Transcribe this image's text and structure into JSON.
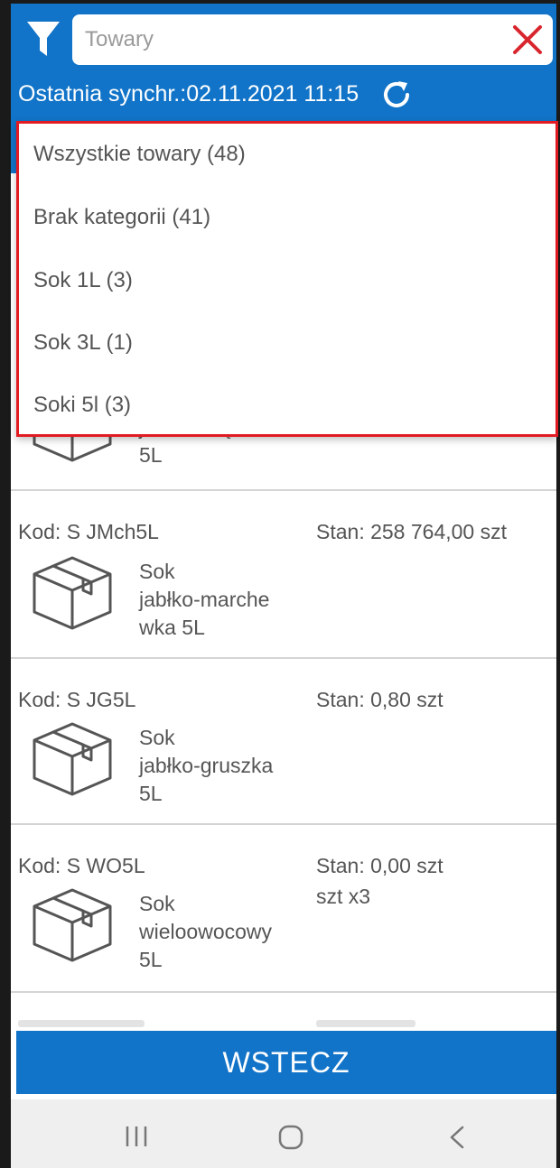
{
  "header": {
    "search_placeholder": "Towary",
    "sync_label": "Ostatnia synchr.:02.11.2021 11:15",
    "accent_color": "#1274c8"
  },
  "dropdown": {
    "border_color": "#e21b23",
    "items": [
      "Wszystkie towary (48)",
      "Brak kategorii (41)",
      "Sok 1L (3)",
      "Sok 3L (1)",
      "Soki 5l (3)"
    ]
  },
  "list": {
    "partial_top": {
      "name_line1": "jabłko-mięta",
      "name_line2": "5L"
    },
    "items": [
      {
        "code": "Kod:  S JMch5L",
        "stock": "Stan:   258 764,00 szt",
        "name_lines": [
          "Sok",
          "jabłko-marche",
          "wka 5L"
        ]
      },
      {
        "code": "Kod:  S JG5L",
        "stock": "Stan:   0,80 szt",
        "name_lines": [
          "Sok",
          "jabłko-gruszka",
          "5L"
        ]
      },
      {
        "code": "Kod:  S WO5L",
        "stock": "Stan:   0,00 szt",
        "stock_extra": "szt x3",
        "name_lines": [
          "Sok",
          "wieloowocowy",
          "5L"
        ]
      }
    ]
  },
  "footer": {
    "back_label": "WSTECZ"
  },
  "icons": {
    "filter": "filter-icon",
    "close": "close-icon",
    "refresh": "refresh-icon",
    "product": "box-icon",
    "nav_recent": "recent-apps-icon",
    "nav_home": "home-icon",
    "nav_back": "back-arrow-icon"
  }
}
